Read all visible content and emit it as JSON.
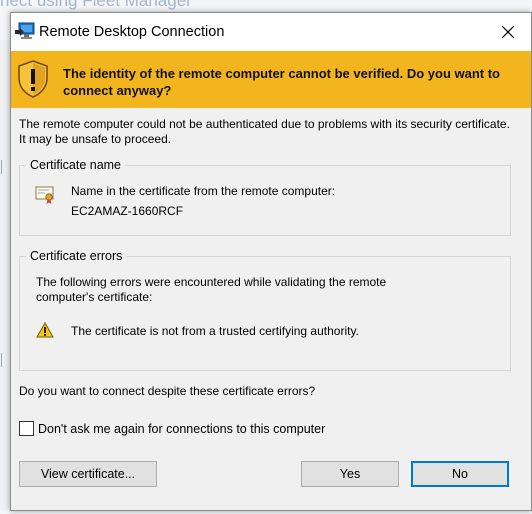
{
  "background": {
    "heading": "nect using Fleet Manager"
  },
  "dialog": {
    "title": "Remote Desktop Connection",
    "banner_text": "The identity of the remote computer cannot be verified. Do you want to connect anyway?",
    "intro": "The remote computer could not be authenticated due to problems with its security certificate. It may be unsafe to proceed.",
    "certificate_group": {
      "label": "Certificate name",
      "line1": "Name in the certificate from the remote computer:",
      "line2": "EC2AMAZ-1660RCF"
    },
    "errors_group": {
      "label": "Certificate errors",
      "intro": "The following errors were encountered while validating the remote computer's certificate:",
      "item": "The certificate is not from a trusted certifying authority."
    },
    "question": "Do you want to connect despite these certificate errors?",
    "checkbox_label": "Don't ask me again for connections to this computer",
    "checkbox_checked": false,
    "buttons": {
      "view_certificate": "View certificate...",
      "yes": "Yes",
      "no": "No"
    }
  },
  "colors": {
    "banner": "#f2b51e",
    "default_button_border": "#0078d7"
  },
  "icons": {
    "title": "rdp-monitor-icon",
    "close": "close-icon",
    "banner": "warning-shield-icon",
    "certificate": "certificate-icon",
    "warning": "warning-triangle-icon"
  }
}
